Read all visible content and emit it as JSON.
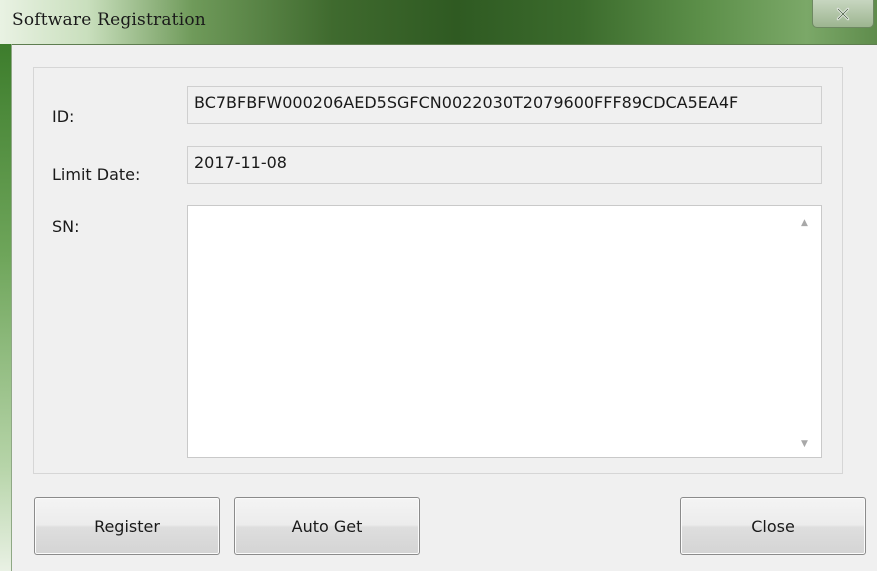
{
  "window": {
    "title": "Software Registration",
    "close_glyph": "x"
  },
  "form": {
    "id_label": "ID:",
    "id_value": "BC7BFBFW000206AED5SGFCN0022030T2079600FFF89CDCA5EA4F",
    "limit_label": "Limit Date:",
    "limit_value": "2017-11-08",
    "sn_label": "SN:",
    "sn_value": ""
  },
  "buttons": {
    "register": "Register",
    "auto_get": "Auto Get",
    "close": "Close"
  },
  "icons": {
    "close": "close-icon",
    "scroll_up": "scroll-up-arrow-icon",
    "scroll_down": "scroll-down-arrow-icon"
  }
}
